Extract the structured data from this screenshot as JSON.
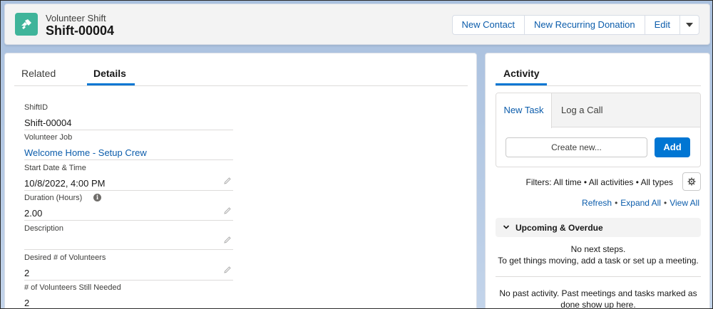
{
  "header": {
    "object_type": "Volunteer Shift",
    "record_name": "Shift-00004",
    "actions": [
      "New Contact",
      "New Recurring Donation",
      "Edit"
    ],
    "icon": "volunteer-hand-icon",
    "icon_color": "#3fb49a"
  },
  "tabs": [
    "Related",
    "Details"
  ],
  "active_tab": "Details",
  "fields": {
    "shift_id": {
      "label": "ShiftID",
      "value": "Shift-00004"
    },
    "volunteer_job": {
      "label": "Volunteer Job",
      "value": "Welcome Home - Setup Crew"
    },
    "start": {
      "label": "Start Date & Time",
      "value": "10/8/2022, 4:00 PM"
    },
    "duration": {
      "label": "Duration (Hours)",
      "value": "2.00"
    },
    "description": {
      "label": "Description",
      "value": ""
    },
    "desired": {
      "label": "Desired # of Volunteers",
      "value": "2"
    },
    "still_needed": {
      "label": "# of Volunteers Still Needed",
      "value": "2"
    }
  },
  "activity": {
    "tab": "Activity",
    "composer_tabs": [
      "New Task",
      "Log a Call"
    ],
    "create_placeholder": "Create new...",
    "add_label": "Add",
    "filters": "Filters: All time • All activities • All types",
    "links": [
      "Refresh",
      "Expand All",
      "View All"
    ],
    "section_title": "Upcoming & Overdue",
    "empty_line1": "No next steps.",
    "empty_line2": "To get things moving, add a task or set up a meeting.",
    "past_line1": "No past activity. Past meetings and tasks marked as",
    "past_line2": "done show up here."
  },
  "colors": {
    "brand": "#0176d3",
    "link": "#0b5cab"
  }
}
